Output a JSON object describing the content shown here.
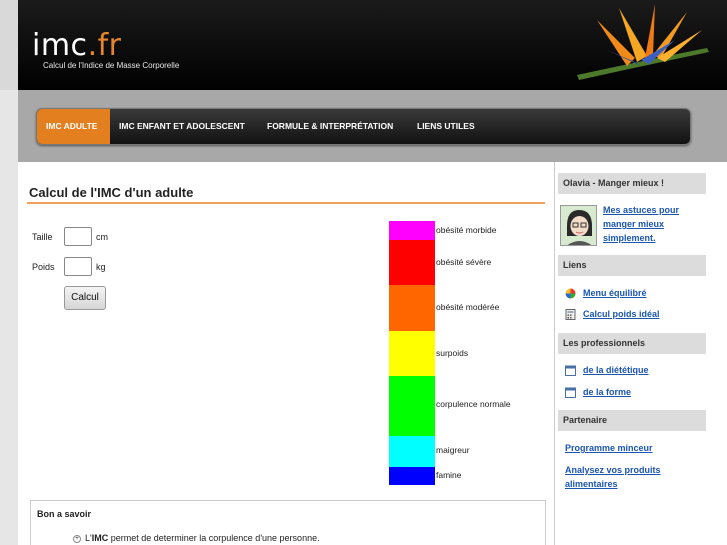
{
  "header": {
    "logo_main": "imc",
    "logo_ext": ".fr",
    "tagline": "Calcul de l'Indice de Masse Corporelle"
  },
  "nav": {
    "items": [
      {
        "label": "IMC ADULTE",
        "active": true
      },
      {
        "label": "IMC ENFANT ET ADOLESCENT"
      },
      {
        "label": "FORMULE & INTERPRÉTATION"
      },
      {
        "label": "LIENS UTILES"
      }
    ]
  },
  "main": {
    "title": "Calcul de l'IMC d'un adulte",
    "form": {
      "height_label": "Taille",
      "height_unit": "cm",
      "height_value": "",
      "weight_label": "Poids",
      "weight_unit": "kg",
      "weight_value": "",
      "submit_label": "Calcul"
    },
    "scale": [
      {
        "label": "obésité morbide",
        "color": "#ff00ff"
      },
      {
        "label": "obésité sévère",
        "color": "#ff0000"
      },
      {
        "label": "obésité modérée",
        "color": "#ff6600"
      },
      {
        "label": "surpoids",
        "color": "#ffff00"
      },
      {
        "label": "corpulence normale",
        "color": "#00ff00"
      },
      {
        "label": "maigreur",
        "color": "#00ffff"
      },
      {
        "label": "famine",
        "color": "#0000ff"
      }
    ],
    "info": {
      "title": "Bon a savoir",
      "line_prefix": "L'",
      "line_bold": "IMC",
      "line_rest": " permet de determiner la corpulence d'une personne."
    }
  },
  "sidebar": {
    "olivia": {
      "heading": "Olavia - Manger mieux !",
      "link": "Mes astuces pour manger mieux simplement."
    },
    "liens": {
      "heading": "Liens",
      "items": [
        "Menu équilibré",
        "Calcul poids idéal"
      ]
    },
    "pros": {
      "heading": "Les professionnels",
      "items": [
        "de la diététique",
        "de la forme"
      ]
    },
    "partenaire": {
      "heading": "Partenaire",
      "items": [
        "Programme minceur",
        "Analysez vos produits alimentaires"
      ]
    }
  },
  "colors": {
    "accent": "#e37f1f",
    "link": "#1a55b0"
  }
}
